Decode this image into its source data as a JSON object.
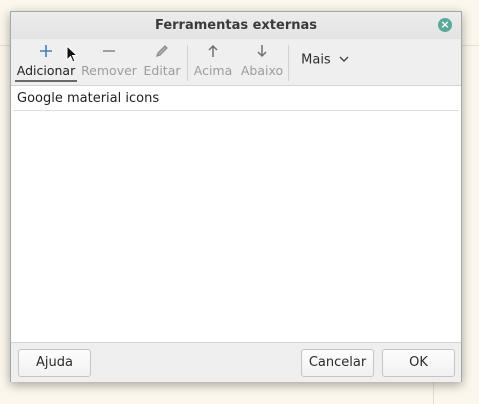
{
  "dialog": {
    "title": "Ferramentas externas",
    "close_icon": "close-icon"
  },
  "toolbar": {
    "add": {
      "label": "Adicionar",
      "icon": "plus-icon",
      "enabled": true
    },
    "remove": {
      "label": "Remover",
      "icon": "minus-icon",
      "enabled": false
    },
    "edit": {
      "label": "Editar",
      "icon": "pencil-icon",
      "enabled": false
    },
    "up": {
      "label": "Acima",
      "icon": "arrow-up-icon",
      "enabled": false
    },
    "down": {
      "label": "Abaixo",
      "icon": "arrow-down-icon",
      "enabled": false
    },
    "more": {
      "label": "Mais",
      "icon": "chevron-down-icon"
    }
  },
  "tools_list": [
    {
      "name": "Google material icons"
    }
  ],
  "footer": {
    "help": "Ajuda",
    "cancel": "Cancelar",
    "ok": "OK"
  },
  "colors": {
    "accent": "#5aa99a",
    "titlebar": "#e6e6e6",
    "page_background": "#fbf7ec"
  }
}
